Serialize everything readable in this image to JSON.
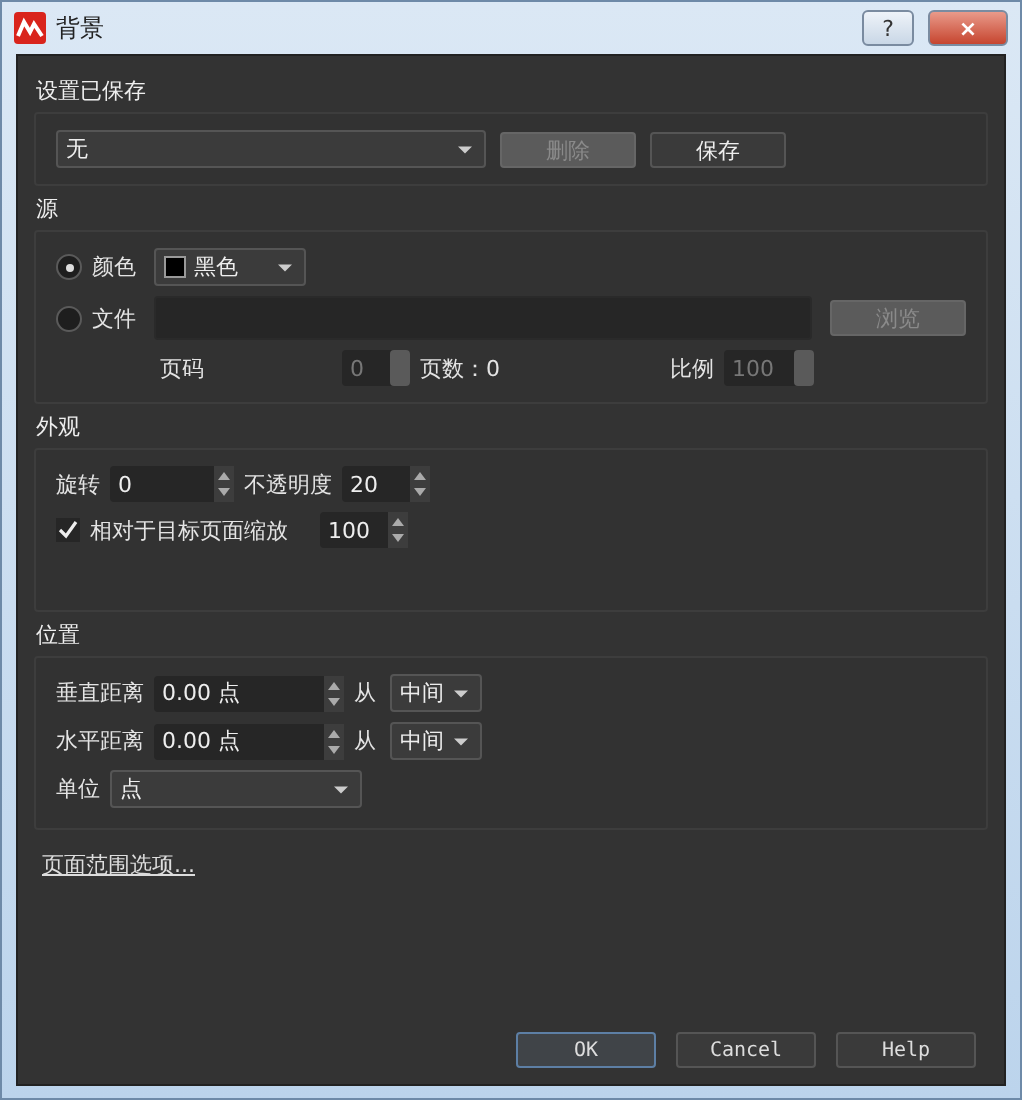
{
  "window": {
    "title": "背景",
    "help": "?",
    "close": "×"
  },
  "saved_settings": {
    "heading": "设置已保存",
    "preset": "无",
    "delete": {
      "label": "删除",
      "disabled": true
    },
    "save": {
      "label": "保存",
      "disabled": false
    }
  },
  "source": {
    "heading": "源",
    "color_option": {
      "label": "颜色",
      "selected": true,
      "value": "黑色"
    },
    "file_option": {
      "label": "文件",
      "selected": false
    },
    "browse": {
      "label": "浏览",
      "disabled": true
    },
    "page_label": "页码",
    "page_value": "0",
    "page_count": "页数：0",
    "scale_label": "比例",
    "scale_value": "100"
  },
  "appearance": {
    "heading": "外观",
    "rotation_label": "旋转",
    "rotation": "0",
    "opacity_label": "不透明度",
    "opacity": "20",
    "relative_scale": {
      "label": "相对于目标页面缩放",
      "checked": true,
      "value": "100"
    }
  },
  "position": {
    "heading": "位置",
    "rows": [
      {
        "label": "垂直距离",
        "value": "0.00 点",
        "from": "从",
        "anchor": "中间"
      },
      {
        "label": "水平距离",
        "value": "0.00 点",
        "from": "从",
        "anchor": "中间"
      }
    ],
    "unit_label": "单位",
    "unit": "点"
  },
  "page_range_link": "页面范围选项...",
  "buttons": [
    {
      "label": "OK",
      "selected": true
    },
    {
      "label": "Cancel",
      "selected": false
    },
    {
      "label": "Help",
      "selected": false
    }
  ]
}
